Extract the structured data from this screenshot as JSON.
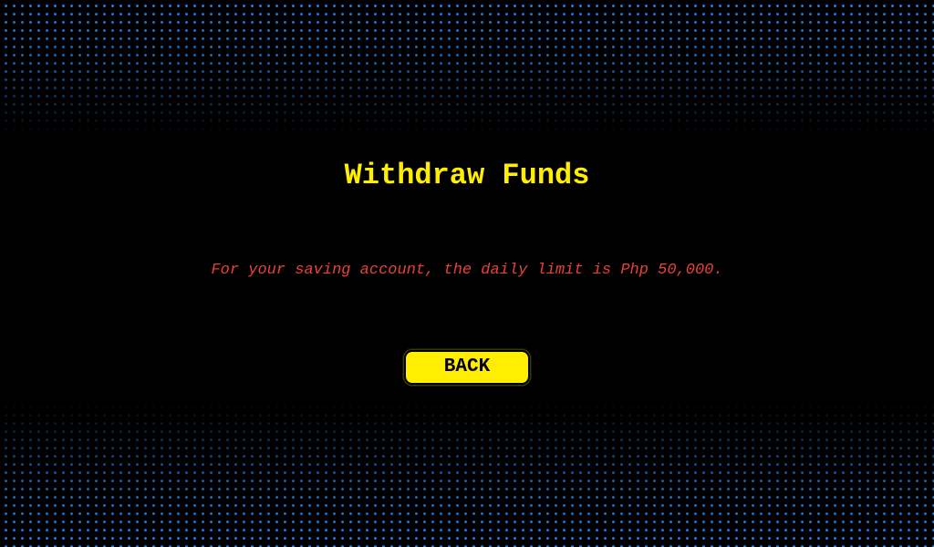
{
  "screen": {
    "title": "Withdraw Funds",
    "message": "For your saving account, the daily limit is Php 50,000.",
    "back_label": "BACK"
  },
  "colors": {
    "background": "#000000",
    "title": "#ffee00",
    "message": "#e8413c",
    "button_bg": "#ffee00",
    "button_text": "#000000",
    "dots": "#1e7be6"
  }
}
